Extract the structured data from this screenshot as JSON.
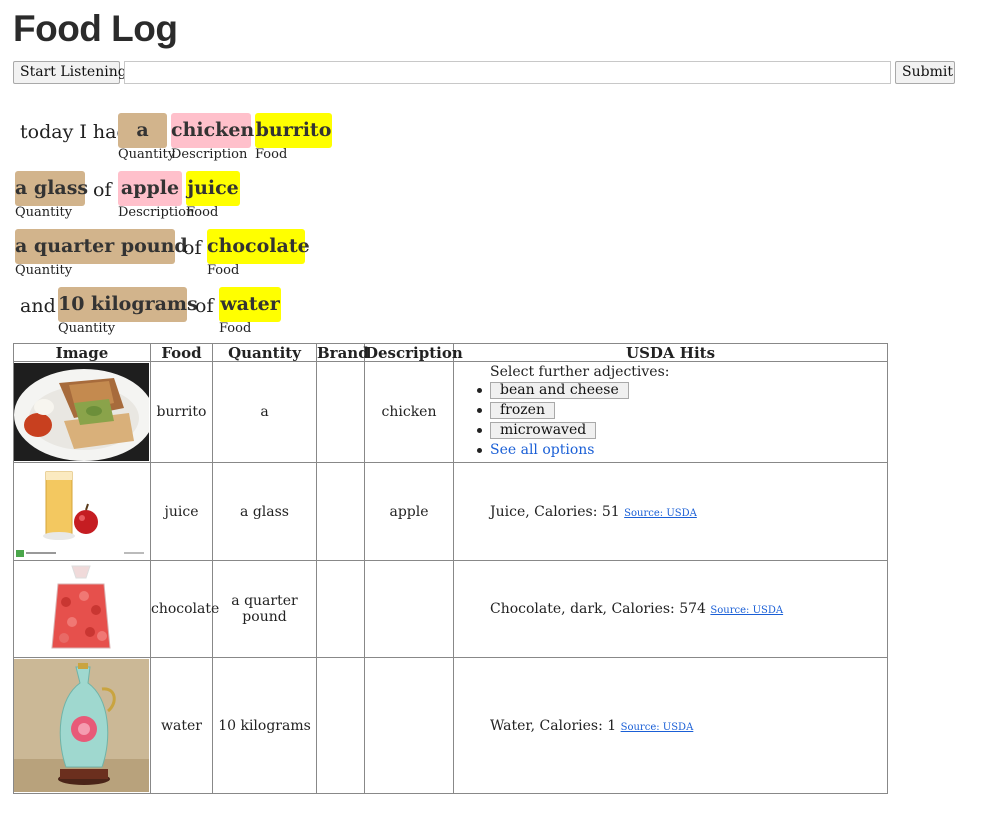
{
  "app": {
    "title": "Food Log"
  },
  "controls": {
    "listen_label": "Start Listening",
    "submit_label": "Submit",
    "input_value": ""
  },
  "sentence": {
    "plain": [
      "today I had",
      "of",
      "of",
      "and",
      "of"
    ],
    "chips": [
      {
        "text": "a",
        "tag": "Quantity"
      },
      {
        "text": "chicken",
        "tag": "Description"
      },
      {
        "text": "burrito",
        "tag": "Food"
      },
      {
        "text": "a glass",
        "tag": "Quantity"
      },
      {
        "text": "apple",
        "tag": "Description"
      },
      {
        "text": "juice",
        "tag": "Food"
      },
      {
        "text": "a quarter pound",
        "tag": "Quantity"
      },
      {
        "text": "chocolate",
        "tag": "Food"
      },
      {
        "text": "10 kilograms",
        "tag": "Quantity"
      },
      {
        "text": "water",
        "tag": "Food"
      }
    ]
  },
  "colors": {
    "quantity": "#d2b48c",
    "description": "#ffc0cb",
    "food": "#ffff00",
    "link": "#1a5fd6"
  },
  "table": {
    "headers": [
      "Image",
      "Food",
      "Quantity",
      "Brand",
      "Description",
      "USDA Hits"
    ],
    "rows": [
      {
        "food": "burrito",
        "quantity": "a",
        "brand": "",
        "description": "chicken",
        "image_icon": "burrito-photo",
        "adjectives_label": "Select further adjectives:",
        "adjectives": [
          "bean and cheese",
          "frozen",
          "microwaved"
        ],
        "see_all": "See all options"
      },
      {
        "food": "juice",
        "quantity": "a glass",
        "brand": "",
        "description": "apple",
        "image_icon": "apple-juice-photo",
        "hit": "Juice, Calories: 51",
        "source": "Source: USDA"
      },
      {
        "food": "chocolate",
        "quantity": "a quarter pound",
        "brand": "",
        "description": "",
        "image_icon": "chocolate-bag-photo",
        "hit": "Chocolate, dark, Calories: 574",
        "source": "Source: USDA"
      },
      {
        "food": "water",
        "quantity": "10 kilograms",
        "brand": "",
        "description": "",
        "image_icon": "vase-photo",
        "hit": "Water, Calories: 1",
        "source": "Source: USDA"
      }
    ]
  }
}
